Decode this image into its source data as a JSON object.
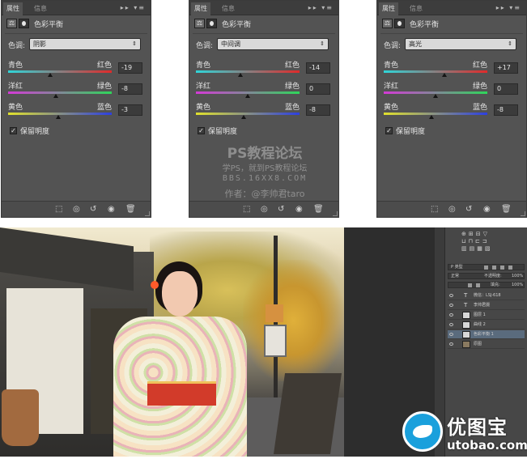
{
  "panels": [
    {
      "tab_properties": "属性",
      "tab_info": "信息",
      "title": "色彩平衡",
      "tone_label": "色调:",
      "tone_value": "阴影",
      "sliders": [
        {
          "left": "青色",
          "right": "红色",
          "value": "-19",
          "position": -19
        },
        {
          "left": "洋红",
          "right": "绿色",
          "value": "-8",
          "position": -8
        },
        {
          "left": "黄色",
          "right": "蓝色",
          "value": "-3",
          "position": -3
        }
      ],
      "preserve_label": "保留明度"
    },
    {
      "tab_properties": "属性",
      "tab_info": "信息",
      "title": "色彩平衡",
      "tone_label": "色调:",
      "tone_value": "中间调",
      "sliders": [
        {
          "left": "青色",
          "right": "红色",
          "value": "-14",
          "position": -14
        },
        {
          "left": "洋红",
          "right": "绿色",
          "value": "0",
          "position": 0
        },
        {
          "left": "黄色",
          "right": "蓝色",
          "value": "-8",
          "position": -8
        }
      ],
      "preserve_label": "保留明度",
      "watermark": {
        "line1": "PS教程论坛",
        "line2": "学PS，就到PS教程论坛",
        "line3": "BBS.16XX8.COM",
        "line4": "作者：@李帅君taro"
      }
    },
    {
      "tab_properties": "属性",
      "tab_info": "信息",
      "title": "色彩平衡",
      "tone_label": "色调:",
      "tone_value": "高光",
      "sliders": [
        {
          "left": "青色",
          "right": "红色",
          "value": "+17",
          "position": 17
        },
        {
          "left": "洋红",
          "right": "绿色",
          "value": "0",
          "position": 0
        },
        {
          "left": "黄色",
          "right": "蓝色",
          "value": "-8",
          "position": -8
        }
      ],
      "preserve_label": "保留明度"
    }
  ],
  "slider_range": [
    -100,
    100
  ],
  "panel_menu": "▸▸ ▾≡",
  "footer_icons": [
    "clip-to-layer-icon",
    "view-previous-icon",
    "reset-icon",
    "visibility-icon",
    "delete-icon"
  ],
  "layers_panel": {
    "kind": "P 类型",
    "mode": "正常",
    "opacity_label": "不透明度:",
    "opacity": "100%",
    "fill_label": "填充:",
    "fill": "100%",
    "layers": [
      {
        "type": "text",
        "name": "微信：LSJ-618"
      },
      {
        "type": "text",
        "name": "李帅君摄"
      },
      {
        "type": "image",
        "name": "图层 1"
      },
      {
        "type": "adjust",
        "name": "曲线 2"
      },
      {
        "type": "adjust",
        "name": "色彩平衡 1",
        "selected": true
      },
      {
        "type": "image",
        "name": "原图"
      }
    ]
  },
  "logo": {
    "cn": "优图宝",
    "en": "utobao.com"
  },
  "colors": {
    "panel_bg": "#535353",
    "accent_logo": "#1aa0dc"
  }
}
